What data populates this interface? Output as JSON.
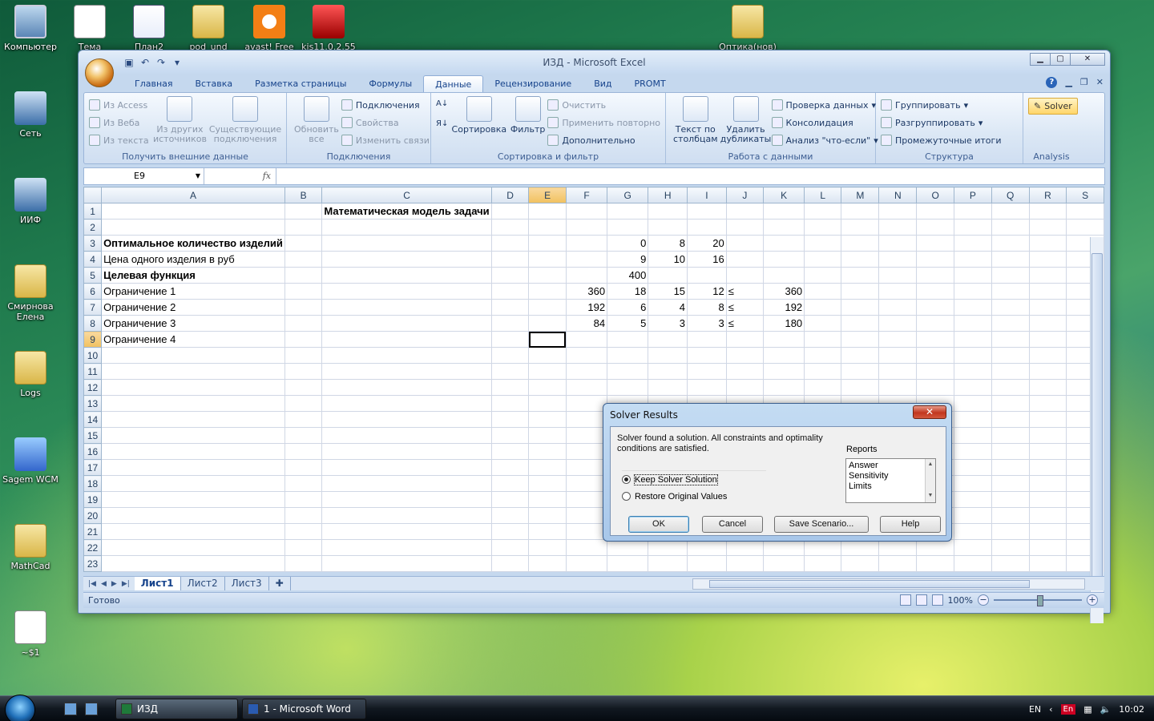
{
  "desktop": {
    "icons": [
      {
        "label": "Компьютер"
      },
      {
        "label": "Тема"
      },
      {
        "label": "План2"
      },
      {
        "label": "pod_und"
      },
      {
        "label": "avast! Free"
      },
      {
        "label": "kis11.0.2.55"
      },
      {
        "label": "Оптика(нов)"
      },
      {
        "label": "Сеть"
      },
      {
        "label": "ИИФ"
      },
      {
        "label": "Смирнова Елена"
      },
      {
        "label": "Logs"
      },
      {
        "label": "Sagem WCM"
      },
      {
        "label": "MathCad"
      },
      {
        "label": "~$1"
      }
    ]
  },
  "excel": {
    "title": "ИЗД - Microsoft Excel",
    "tabs": [
      {
        "label": "Главная"
      },
      {
        "label": "Вставка"
      },
      {
        "label": "Разметка страницы"
      },
      {
        "label": "Формулы"
      },
      {
        "label": "Данные",
        "active": true
      },
      {
        "label": "Рецензирование"
      },
      {
        "label": "Вид"
      },
      {
        "label": "PROMT"
      }
    ],
    "ribbon": {
      "get_external": {
        "label": "Получить внешние данные",
        "from_access": "Из Access",
        "from_web": "Из Веба",
        "from_text": "Из текста",
        "from_other": "Из других источников",
        "existing": "Существующие подключения"
      },
      "connections": {
        "label": "Подключения",
        "refresh": "Обновить все",
        "conn": "Подключения",
        "props": "Свойства",
        "edit_links": "Изменить связи"
      },
      "sort_filter": {
        "label": "Сортировка и фильтр",
        "sort": "Сортировка",
        "filter": "Фильтр",
        "clear": "Очистить",
        "reapply": "Применить повторно",
        "advanced": "Дополнительно"
      },
      "data_tools": {
        "label": "Работа с данными",
        "text_to_cols": "Текст по столбцам",
        "remove_dup": "Удалить дубликаты",
        "validation": "Проверка данных",
        "consolidate": "Консолидация",
        "whatif": "Анализ \"что-если\""
      },
      "outline": {
        "label": "Структура",
        "group": "Группировать",
        "ungroup": "Разгруппировать",
        "subtotal": "Промежуточные итоги"
      },
      "analysis": {
        "label": "Analysis",
        "solver": "Solver"
      }
    },
    "name_box": "E9",
    "fx": "fx",
    "columns": [
      "A",
      "B",
      "C",
      "D",
      "E",
      "F",
      "G",
      "H",
      "I",
      "J",
      "K",
      "L",
      "M",
      "N",
      "O",
      "P",
      "Q",
      "R",
      "S"
    ],
    "rows": [
      {
        "n": "1",
        "A": "",
        "C": "Математическая модель задачи",
        "F": "",
        "G": "",
        "H": "",
        "I": "",
        "J": "",
        "K": ""
      },
      {
        "n": "2",
        "A": "",
        "C": "",
        "F": "",
        "G": "",
        "H": "",
        "I": "",
        "J": "",
        "K": ""
      },
      {
        "n": "3",
        "A": "Оптимальное количество изделий",
        "C": "",
        "F": "",
        "G": "0",
        "H": "8",
        "I": "20",
        "J": "",
        "K": ""
      },
      {
        "n": "4",
        "A": "Цена одного изделия в руб",
        "C": "",
        "F": "",
        "G": "9",
        "H": "10",
        "I": "16",
        "J": "",
        "K": ""
      },
      {
        "n": "5",
        "A": "Целевая функция",
        "C": "",
        "F": "",
        "G": "400",
        "H": "",
        "I": "",
        "J": "",
        "K": ""
      },
      {
        "n": "6",
        "A": "Ограничение 1",
        "C": "",
        "F": "360",
        "G": "18",
        "H": "15",
        "I": "12",
        "J": "≤",
        "K": "360"
      },
      {
        "n": "7",
        "A": "Ограничение 2",
        "C": "",
        "F": "192",
        "G": "6",
        "H": "4",
        "I": "8",
        "J": "≤",
        "K": "192"
      },
      {
        "n": "8",
        "A": "Ограничение 3",
        "C": "",
        "F": "84",
        "G": "5",
        "H": "3",
        "I": "3",
        "J": "≤",
        "K": "180"
      },
      {
        "n": "9",
        "A": "Ограничение 4",
        "C": "",
        "F": "",
        "G": "",
        "H": "",
        "I": "",
        "J": "",
        "K": ""
      },
      {
        "n": "10"
      },
      {
        "n": "11"
      },
      {
        "n": "12"
      },
      {
        "n": "13"
      },
      {
        "n": "14"
      },
      {
        "n": "15"
      },
      {
        "n": "16"
      },
      {
        "n": "17"
      },
      {
        "n": "18"
      },
      {
        "n": "19"
      },
      {
        "n": "20"
      },
      {
        "n": "21"
      },
      {
        "n": "22"
      },
      {
        "n": "23"
      }
    ],
    "bold_rows": [
      "1",
      "3",
      "5"
    ],
    "active_cell": {
      "row": "9",
      "col": "E"
    },
    "sheets": [
      "Лист1",
      "Лист2",
      "Лист3"
    ],
    "status": "Готово",
    "zoom": "100%"
  },
  "solver": {
    "title": "Solver Results",
    "message": "Solver found a solution.  All constraints and optimality conditions are satisfied.",
    "reports_label": "Reports",
    "reports": [
      "Answer",
      "Sensitivity",
      "Limits"
    ],
    "keep": "Keep Solver Solution",
    "restore": "Restore Original Values",
    "ok": "OK",
    "cancel": "Cancel",
    "save": "Save Scenario...",
    "help": "Help"
  },
  "taskbar": {
    "tasks": [
      {
        "label": "ИЗД"
      },
      {
        "label": "1 - Microsoft Word"
      }
    ],
    "lang": "EN",
    "lang2": "En",
    "time": "10:02"
  }
}
